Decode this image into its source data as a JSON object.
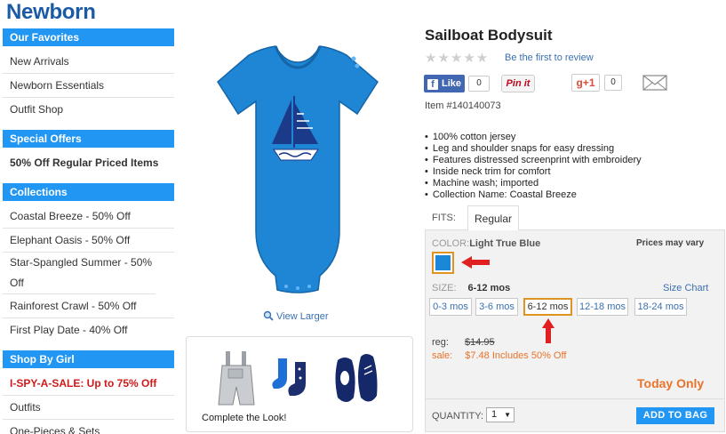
{
  "page": {
    "title": "Newborn"
  },
  "sidebar": {
    "sections": [
      {
        "header": "Our Favorites",
        "items": [
          "New Arrivals",
          "Newborn Essentials",
          "Outfit Shop"
        ]
      },
      {
        "header": "Special Offers",
        "items": [
          "50% Off Regular Priced Items"
        ]
      },
      {
        "header": "Collections",
        "items": [
          "Coastal Breeze - 50% Off",
          "Elephant Oasis - 50% Off",
          "Star-Spangled Summer - 50% Off",
          "Rainforest Crawl - 50% Off",
          "First Play Date - 40% Off"
        ]
      },
      {
        "header": "Shop By Girl",
        "items": [
          "I-SPY-A-SALE: Up to 75% Off",
          "Outfits",
          "One-Pieces & Sets"
        ]
      }
    ]
  },
  "image": {
    "view_larger": "View Larger",
    "complete_look": "Complete the Look!"
  },
  "product": {
    "title": "Sailboat Bodysuit",
    "stars": "★★★★★",
    "review_link": "Be the first to review",
    "social": {
      "like_label": "Like",
      "like_count": "0",
      "pinit_label": "Pin it",
      "gplus_label": "g+1",
      "gplus_count": "0"
    },
    "item_number": "Item #140140073",
    "features": [
      "100% cotton jersey",
      "Leg and shoulder snaps for easy dressing",
      "Features distressed screenprint with embroidery",
      "Inside neck trim for comfort",
      "Machine wash; imported",
      "Collection Name: Coastal Breeze"
    ],
    "fits_label": "FITS:",
    "fits_tab": "Regular",
    "color_label": "COLOR:",
    "color_value": "Light True Blue",
    "prices_vary": "Prices may vary",
    "swatch_color": "#1a88d6",
    "size_label": "SIZE:",
    "size_value": "6-12 mos",
    "size_chart": "Size Chart",
    "sizes": [
      "0-3 mos",
      "3-6 mos",
      "6-12 mos",
      "12-18 mos",
      "18-24 mos"
    ],
    "selected_size": "6-12 mos",
    "reg_label": "reg:",
    "reg_price": "$14.95",
    "sale_label": "sale:",
    "sale_price": "$7.48 Includes 50% Off",
    "today_only": "Today Only",
    "quantity_label": "QUANTITY:",
    "quantity_value": "1",
    "add_to_bag": "ADD TO BAG"
  },
  "colors": {
    "accent": "#2196f3",
    "title": "#1b5aa6",
    "sale": "#e8732a",
    "selected_border": "#e09321",
    "annotation_arrow": "#e02020"
  }
}
